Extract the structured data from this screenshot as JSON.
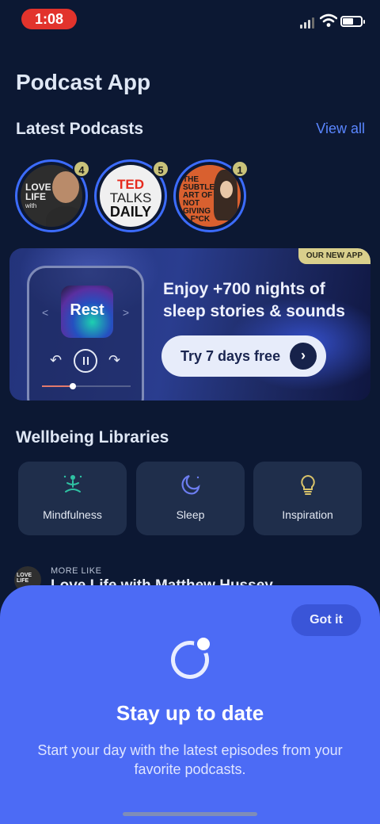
{
  "status_bar": {
    "time": "1:08"
  },
  "header": {
    "title": "Podcast App"
  },
  "latest_podcasts": {
    "title": "Latest Podcasts",
    "view_all": "View all",
    "items": [
      {
        "cover_text": [
          "LOVE",
          "LIFE",
          "with"
        ],
        "badge": "4"
      },
      {
        "cover_text": [
          "TED",
          "TALKS",
          "DAILY"
        ],
        "badge": "5"
      },
      {
        "cover_text": [
          "THE",
          "SUBTLE",
          "ART OF",
          "NOT",
          "GIVING",
          "A F*CK"
        ],
        "badge": "1"
      }
    ]
  },
  "banner": {
    "tag": "OUR NEW APP",
    "app_art_label": "Rest",
    "headline": "Enjoy +700 nights of sleep stories & sounds",
    "cta": "Try 7 days free",
    "playback_progress": 0.35
  },
  "wellbeing": {
    "title": "Wellbeing Libraries",
    "items": [
      {
        "label": "Mindfulness",
        "icon": "meditation-icon",
        "color": "#2fc2a3"
      },
      {
        "label": "Sleep",
        "icon": "moon-icon",
        "color": "#6c7df0"
      },
      {
        "label": "Inspiration",
        "icon": "lightbulb-icon",
        "color": "#d9c36a"
      }
    ]
  },
  "more_like": {
    "label": "MORE LIKE",
    "title": "Love Life with Matthew Hussey",
    "avatar_text": [
      "LOVE",
      "LIFE"
    ]
  },
  "sheet": {
    "got_it": "Got it",
    "title": "Stay up to date",
    "description": "Start your day with the latest episodes from your favorite podcasts."
  },
  "colors": {
    "background": "#0c1833",
    "accent": "#4c6bf5",
    "link": "#5a86ff"
  }
}
